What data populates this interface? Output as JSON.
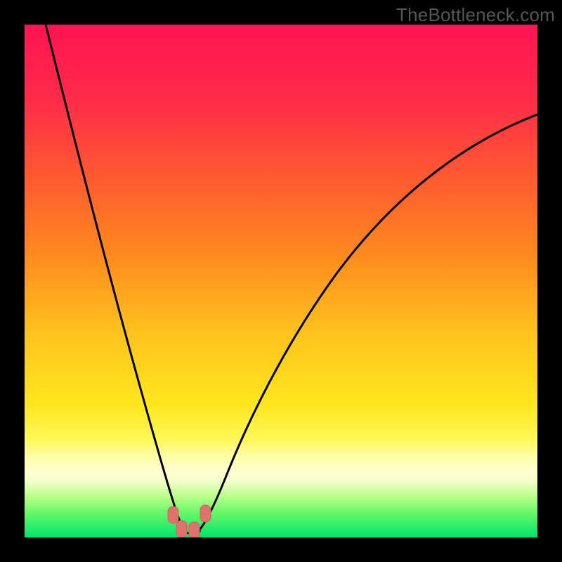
{
  "watermark": "TheBottleneck.com",
  "colors": {
    "frame": "#000000",
    "top": "#ff1452",
    "red": "#ff3c3c",
    "orange": "#ff8c1e",
    "yellow": "#ffe51e",
    "pale_yellow": "#ffff9e",
    "lime": "#8aff5a",
    "green": "#00e86b",
    "curve": "#000000",
    "marker": "#e0726e"
  },
  "chart_data": {
    "type": "line",
    "title": "",
    "xlabel": "",
    "ylabel": "",
    "xlim": [
      0,
      100
    ],
    "ylim": [
      0,
      100
    ],
    "gradient_stops": [
      {
        "pct": 0,
        "note": "top magenta-red"
      },
      {
        "pct": 30,
        "note": "red-orange"
      },
      {
        "pct": 55,
        "note": "orange-yellow"
      },
      {
        "pct": 78,
        "note": "yellow"
      },
      {
        "pct": 86,
        "note": "pale yellow band"
      },
      {
        "pct": 94,
        "note": "lime"
      },
      {
        "pct": 100,
        "note": "green floor"
      }
    ],
    "series": [
      {
        "name": "bottleneck-curve",
        "note": "V-shaped curve; y is the percentage bottleneck, minimum ≈0 around x≈30–34; rises steeply on both sides. Values estimated from vertical gradient position (0 at bottom, 100 at top).",
        "x": [
          4,
          8,
          12,
          16,
          20,
          24,
          27,
          29,
          30,
          32,
          34,
          36,
          40,
          46,
          54,
          64,
          76,
          90,
          100
        ],
        "y": [
          100,
          84,
          68,
          52,
          36,
          20,
          8,
          2,
          0,
          0,
          2,
          6,
          16,
          30,
          44,
          56,
          66,
          74,
          78
        ]
      }
    ],
    "markers": {
      "note": "Pink rounded markers at the minimum of the curve",
      "points": [
        {
          "x": 28.5,
          "y": 4
        },
        {
          "x": 30.0,
          "y": 1
        },
        {
          "x": 32.0,
          "y": 1
        },
        {
          "x": 34.0,
          "y": 4
        }
      ]
    }
  }
}
